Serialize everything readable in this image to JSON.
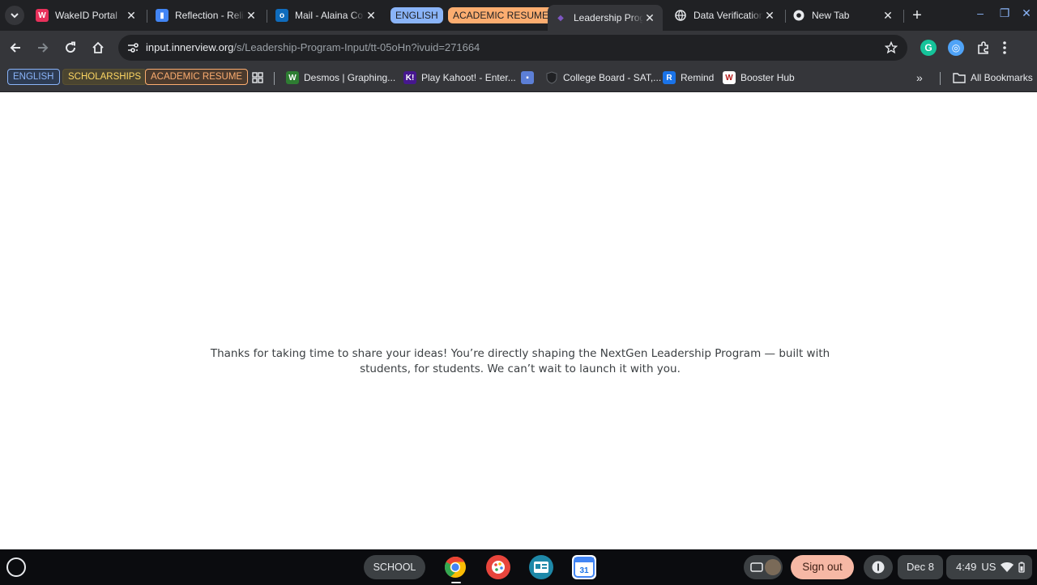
{
  "tabs": [
    {
      "title": "WakeID Portal",
      "icon": "wakeid-icon"
    },
    {
      "title": "Reflection - Religion",
      "icon": "reflection-icon"
    },
    {
      "title": "Mail - Alaina Co",
      "icon": "outlook-mail-icon"
    },
    {
      "title": "Leadership Program",
      "icon": "innerview-icon",
      "active": true
    },
    {
      "title": "Data Verification",
      "icon": "globe-icon"
    },
    {
      "title": "New Tab",
      "icon": "chrome-icon"
    }
  ],
  "tab_groups": {
    "english": "ENGLISH",
    "resume": "ACADEMIC RESUME"
  },
  "omnibox": {
    "host": "input.innerview.org",
    "path": "/s/Leadership-Program-Input/tt-05oHn?ivuid=271664"
  },
  "bookmark_groups": {
    "english": "ENGLISH",
    "scholarships": "SCHOLARSHIPS",
    "resume": "ACADEMIC RESUME"
  },
  "bookmarks": [
    {
      "label": "Desmos | Graphing...",
      "icon": "desmos-icon"
    },
    {
      "label": "Play Kahoot! - Enter...",
      "icon": "kahoot-icon"
    },
    {
      "label": "",
      "icon": "site-icon"
    },
    {
      "label": "College Board - SAT,...",
      "icon": "college-board-icon"
    },
    {
      "label": "Remind",
      "icon": "remind-icon"
    },
    {
      "label": "Booster Hub",
      "icon": "booster-hub-icon"
    }
  ],
  "all_bookmarks": "All Bookmarks",
  "content": {
    "message": "Thanks for taking  time to share your ideas! You’re directly shaping the NextGen Leadership Program — built with students, for students. We can’t wait to launch it with you."
  },
  "shelf": {
    "desk": "SCHOOL",
    "sign_out": "Sign out",
    "date": "Dec 8",
    "time": "4:49",
    "locale": "US"
  },
  "colors": {
    "tab_strip": "#202124",
    "toolbar": "#35363a",
    "english_group": "#8ab4f8",
    "resume_group": "#fcad70",
    "scholarships_group": "#fdd663",
    "sign_out": "#f6b8a5"
  }
}
